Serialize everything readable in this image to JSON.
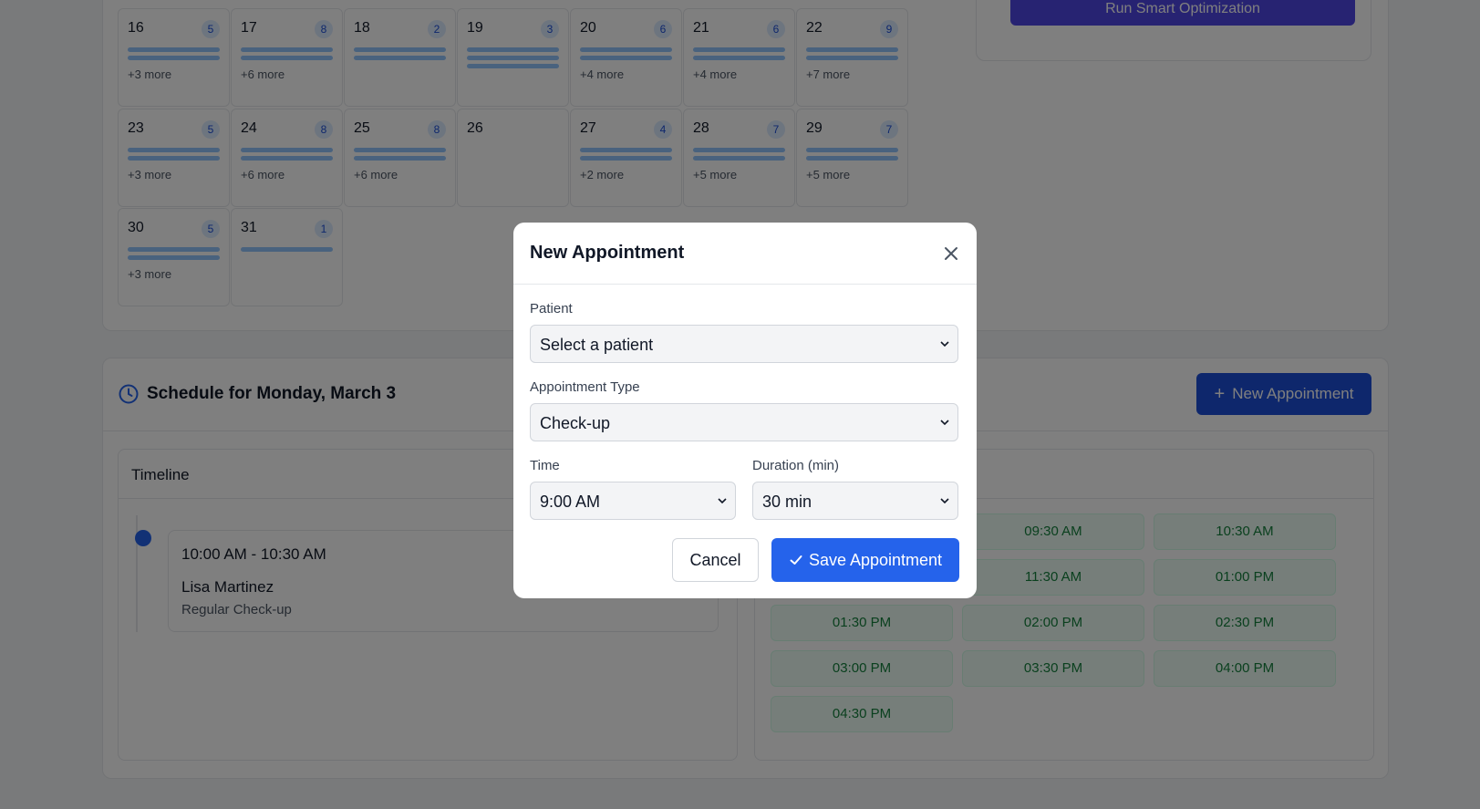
{
  "calendar": {
    "days": [
      {
        "num": "16",
        "count": "5",
        "bars": 2,
        "more": "+3 more"
      },
      {
        "num": "17",
        "count": "8",
        "bars": 2,
        "more": "+6 more"
      },
      {
        "num": "18",
        "count": "2",
        "bars": 2,
        "more": ""
      },
      {
        "num": "19",
        "count": "3",
        "bars": 3,
        "more": ""
      },
      {
        "num": "20",
        "count": "6",
        "bars": 2,
        "more": "+4 more"
      },
      {
        "num": "21",
        "count": "6",
        "bars": 2,
        "more": "+4 more"
      },
      {
        "num": "22",
        "count": "9",
        "bars": 2,
        "more": "+7 more"
      },
      {
        "num": "23",
        "count": "5",
        "bars": 2,
        "more": "+3 more"
      },
      {
        "num": "24",
        "count": "8",
        "bars": 2,
        "more": "+6 more"
      },
      {
        "num": "25",
        "count": "8",
        "bars": 2,
        "more": "+6 more"
      },
      {
        "num": "26",
        "count": "",
        "bars": 0,
        "more": ""
      },
      {
        "num": "27",
        "count": "4",
        "bars": 2,
        "more": "+2 more"
      },
      {
        "num": "28",
        "count": "7",
        "bars": 2,
        "more": "+5 more"
      },
      {
        "num": "29",
        "count": "7",
        "bars": 2,
        "more": "+5 more"
      },
      {
        "num": "30",
        "count": "5",
        "bars": 2,
        "more": "+3 more"
      },
      {
        "num": "31",
        "count": "1",
        "bars": 1,
        "more": ""
      }
    ]
  },
  "optimization": {
    "button_label": "Run Smart Optimization"
  },
  "schedule": {
    "title": "Schedule for Monday, March 3",
    "new_button_label": "New Appointment",
    "timeline_title": "Timeline",
    "appointment": {
      "time": "10:00 AM - 10:30 AM",
      "patient": "Lisa Martinez",
      "type": "Regular Check-up"
    },
    "slots": [
      "09:30 AM",
      "10:30 AM",
      "11:30 AM",
      "01:00 PM",
      "01:30 PM",
      "02:00 PM",
      "02:30 PM",
      "03:00 PM",
      "03:30 PM",
      "04:00 PM",
      "04:30 PM"
    ]
  },
  "modal": {
    "title": "New Appointment",
    "patient_label": "Patient",
    "patient_value": "Select a patient",
    "type_label": "Appointment Type",
    "type_value": "Check-up",
    "time_label": "Time",
    "time_value": "9:00 AM",
    "duration_label": "Duration (min)",
    "duration_value": "30 min",
    "cancel_label": "Cancel",
    "save_label": "Save Appointment"
  },
  "colors": {
    "primary": "#2563eb",
    "optimize": "#4f46e5",
    "slot_text": "#15803d",
    "badge_bg": "#dbeafe"
  }
}
